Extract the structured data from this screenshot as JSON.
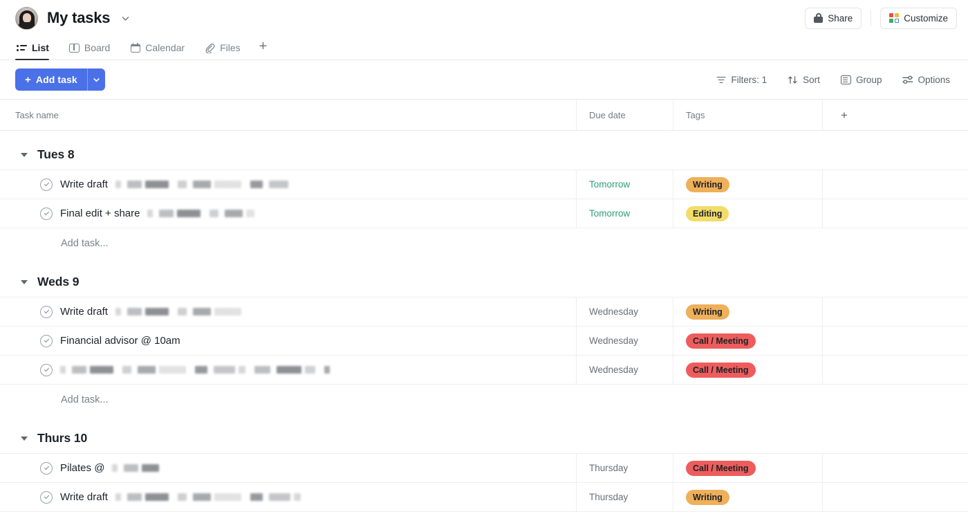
{
  "header": {
    "title": "My tasks",
    "title_caret_icon": "chevron-down-icon",
    "avatar_icon": "user-avatar",
    "share_label": "Share",
    "share_icon": "lock-icon",
    "customize_label": "Customize",
    "customize_icon": "customize-squares-icon"
  },
  "tabs": [
    {
      "label": "List",
      "icon": "list-icon",
      "active": true
    },
    {
      "label": "Board",
      "icon": "board-icon",
      "active": false
    },
    {
      "label": "Calendar",
      "icon": "calendar-icon",
      "active": false
    },
    {
      "label": "Files",
      "icon": "paperclip-icon",
      "active": false
    }
  ],
  "tab_add_label": "+",
  "toolbar": {
    "add_task_label": "Add task",
    "add_task_plus": "+",
    "add_task_caret_icon": "chevron-down-icon",
    "filters_label": "Filters: 1",
    "filters_icon": "filter-icon",
    "sort_label": "Sort",
    "sort_icon": "sort-arrows-icon",
    "group_label": "Group",
    "group_icon": "group-rows-icon",
    "options_label": "Options",
    "options_icon": "sliders-icon"
  },
  "table": {
    "columns": [
      "Task name",
      "Due date",
      "Tags"
    ],
    "add_column_label": "+",
    "add_task_row_label": "Add task...",
    "tag_colors": {
      "Writing": "#eeb05a",
      "Editing": "#f2dd6a",
      "Call / Meeting": "#ee5d5d"
    },
    "groups": [
      {
        "name": "Tues 8",
        "tasks": [
          {
            "name": "Write draft",
            "redacted": true,
            "redaction_width": 250,
            "due": "Tomorrow",
            "due_style": "green",
            "tag": "Writing"
          },
          {
            "name": "Final edit + share",
            "redacted": true,
            "redaction_width": 155,
            "due": "Tomorrow",
            "due_style": "green",
            "tag": "Editing"
          }
        ]
      },
      {
        "name": "Weds 9",
        "tasks": [
          {
            "name": "Write draft",
            "redacted": true,
            "redaction_width": 190,
            "due": "Wednesday",
            "due_style": "gray",
            "tag": "Writing"
          },
          {
            "name": "Financial advisor @ 10am",
            "redacted": false,
            "redaction_width": 0,
            "due": "Wednesday",
            "due_style": "gray",
            "tag": "Call / Meeting"
          },
          {
            "name": "",
            "redacted": true,
            "redaction_width": 390,
            "due": "Wednesday",
            "due_style": "gray",
            "tag": "Call / Meeting"
          }
        ]
      },
      {
        "name": "Thurs 10",
        "tasks": [
          {
            "name": "Pilates @",
            "redacted": true,
            "redaction_width": 68,
            "due": "Thursday",
            "due_style": "gray",
            "tag": "Call / Meeting"
          },
          {
            "name": "Write draft",
            "redacted": true,
            "redaction_width": 270,
            "due": "Thursday",
            "due_style": "gray",
            "tag": "Writing"
          }
        ]
      }
    ]
  }
}
